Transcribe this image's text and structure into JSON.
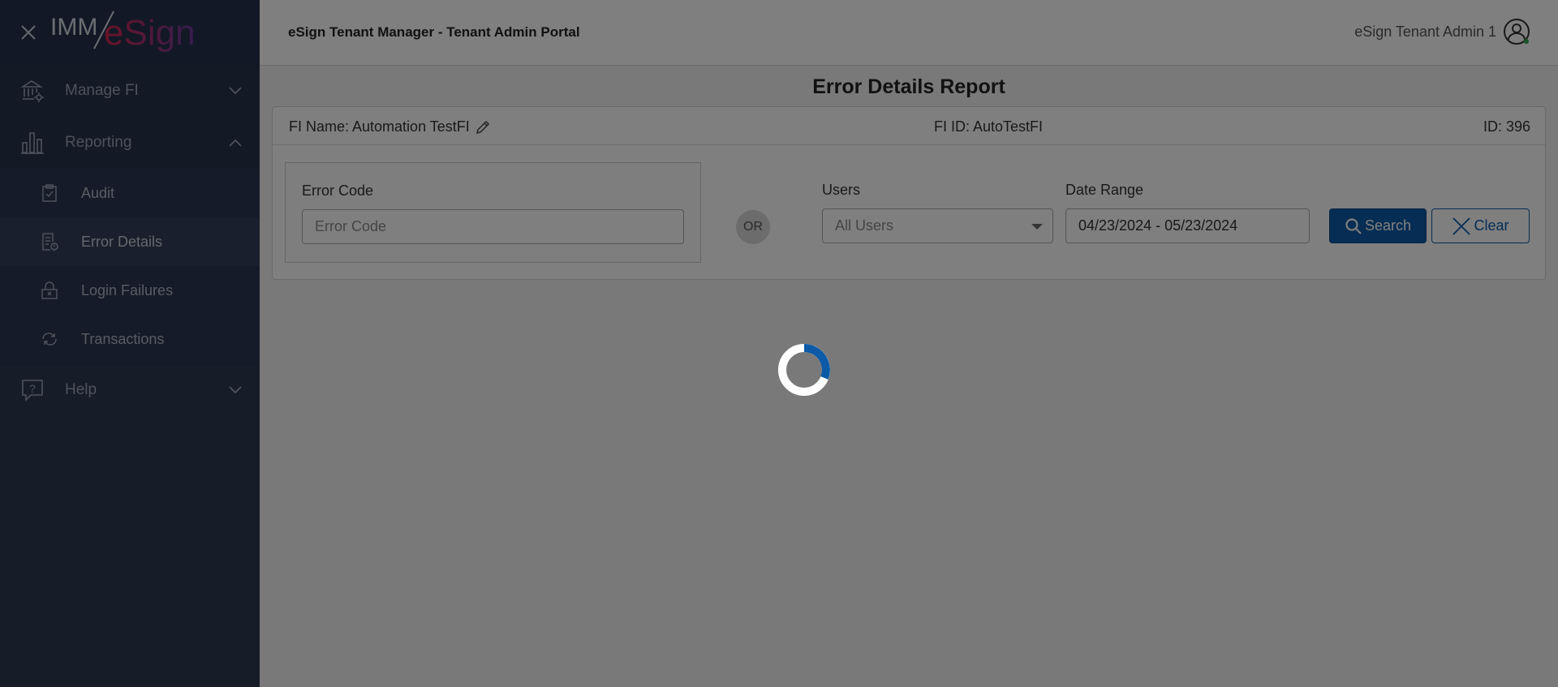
{
  "app": {
    "logo_text_a": "IMM",
    "logo_text_b": "eSign",
    "portal_title": "eSign Tenant Manager - Tenant Admin Portal",
    "user_name": "eSign Tenant Admin 1"
  },
  "sidebar": {
    "manage_fi": "Manage FI",
    "reporting": "Reporting",
    "sub_items": [
      "Audit",
      "Error Details",
      "Login Failures",
      "Transactions"
    ],
    "help": "Help"
  },
  "page": {
    "title": "Error Details Report",
    "fi_name": "FI Name: Automation TestFI",
    "fi_id": "FI ID: AutoTestFI",
    "id": "ID: 396"
  },
  "form": {
    "error_code_label": "Error Code",
    "error_code_placeholder": "Error Code",
    "or_label": "OR",
    "users_label": "Users",
    "users_value": "All Users",
    "date_label": "Date Range",
    "date_value": "04/23/2024 - 05/23/2024",
    "search_label": "Search",
    "clear_label": "Clear"
  },
  "colors": {
    "sidebar_bg": "#2d3a52",
    "primary": "#0d5aa7",
    "logo_gradient": [
      "#d3264f",
      "#6a3c9c"
    ]
  }
}
